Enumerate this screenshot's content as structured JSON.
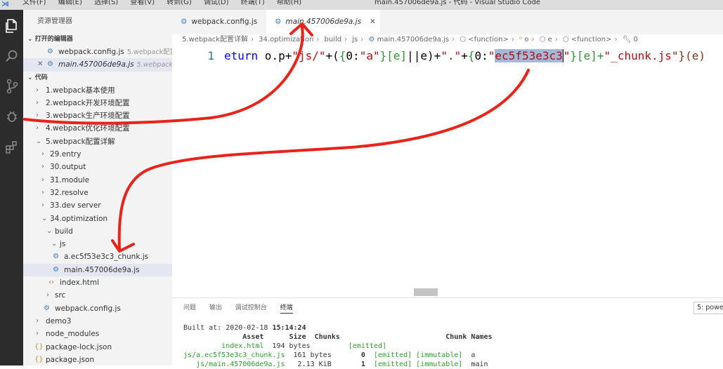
{
  "titlebar": {
    "menu": [
      "文件(F)",
      "编辑(E)",
      "选择(S)",
      "查看(V)",
      "转到(G)",
      "调试(D)",
      "终端(T)",
      "帮助(H)"
    ],
    "window_title": "main.457006de9a.js - 代码 - Visual Studio Code"
  },
  "sidebar": {
    "title": "资源管理器",
    "open_editors_label": "打开的编辑器",
    "open_editors": [
      {
        "name": "webpack.config.js",
        "path": "5.webpack配置..."
      },
      {
        "name": "main.457006de9a.js",
        "path": "5.webpack配..."
      }
    ],
    "workspace_label": "代码",
    "tree": [
      "1.webpack基本使用",
      "2.webpack开发环境配置",
      "3.webpack生产环境配置",
      "4.webpack优化环境配置",
      "5.webpack配置详解",
      "29.entry",
      "30.output",
      "31.module",
      "32.resolve",
      "33.dev server",
      "34.optimization",
      "build",
      "js",
      "a.ec5f53e3c3_chunk.js",
      "main.457006de9a.js",
      "index.html",
      "src",
      "webpack.config.js",
      "demo3",
      "node_modules",
      "package-lock.json",
      "package.json"
    ]
  },
  "tabs": [
    {
      "label": "webpack.config.js"
    },
    {
      "label": "main.457006de9a.js"
    }
  ],
  "breadcrumb": [
    "5.webpack配置详解",
    "34.optimization",
    "build",
    "js",
    "main.457006de9a.js",
    "<function>",
    "o",
    "e",
    "<function>",
    "0"
  ],
  "editor": {
    "line_number": "1",
    "code": {
      "t1": "eturn",
      "t2": " o.p+",
      "t3": "\"js/\"",
      "t4": "+(",
      "t5": "{",
      "t6": "0:",
      "t7": "\"a\"",
      "t8": "}",
      "t9": "[e]",
      "t10": "||e)+",
      "t11": "\".\"",
      "t12": "+",
      "t13": "{",
      "t14": "0:",
      "t15": "\"",
      "t16": "ec5f53e3c3",
      "t17": "\"",
      "t18": "}",
      "t19": "[e]+",
      "t20": "\"_chunk.js\"",
      "t21": "}",
      "t22": "(e)"
    }
  },
  "panel": {
    "tabs": [
      "问题",
      "输出",
      "调试控制台",
      "终端"
    ],
    "select": "5: powe",
    "terminal": {
      "built_label": "Built at: 2020-02-18 ",
      "built_time": "15:14:24",
      "header": "              Asset      Size  Chunks                         Chunk Names",
      "r1_asset": "         index.html",
      "r1_rest": "  194 bytes         ",
      "r1_status": "[emitted]",
      "r2_asset": "js/a.ec5f53e3c3_chunk.js",
      "r2_rest": "  161 bytes       ",
      "r2_chunk": "0",
      "r2_status": "  [emitted] [immutable]",
      "r2_name": "  a",
      "r3_asset": "   js/main.457006de9a.js",
      "r3_rest": "   2.13 KiB       ",
      "r3_chunk": "1",
      "r3_status": "  [emitted] [immutable]",
      "r3_name": "  main"
    }
  },
  "colors": {
    "annotation": "#e8231a",
    "activity_bar": "#2c2c2c",
    "selection": "#a6b7d8"
  },
  "icons": [
    "vscode-logo-icon",
    "files-icon",
    "search-icon",
    "source-control-icon",
    "debug-icon",
    "extensions-icon",
    "gear-icon",
    "chevron-right-icon",
    "chevron-down-icon",
    "close-icon",
    "html-icon",
    "json-icon"
  ]
}
